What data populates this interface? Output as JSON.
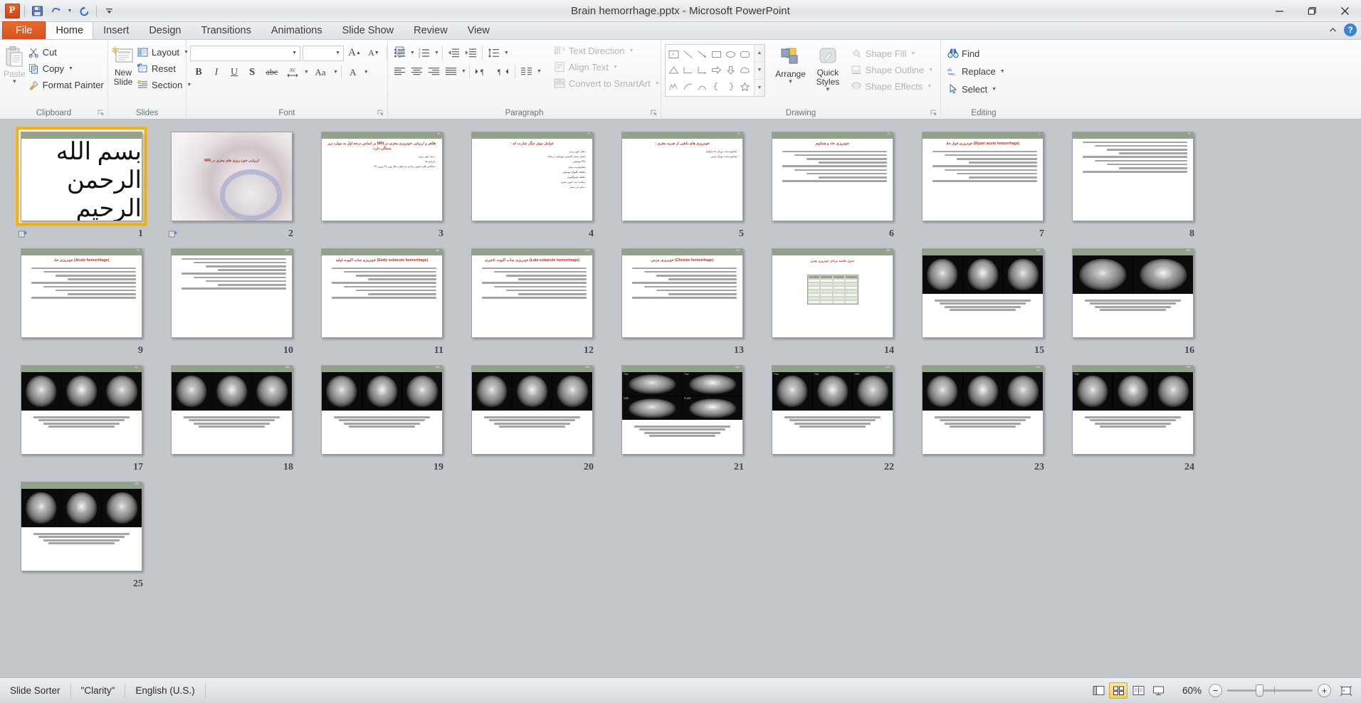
{
  "window": {
    "title": "Brain hemorrhage.pptx  -  Microsoft PowerPoint",
    "app_logo": "powerpoint-logo",
    "minimize": "—",
    "restore": "❐",
    "close": "✕",
    "ribbon_collapse": "ribbon-collapse-icon",
    "help": "?"
  },
  "quick_access": [
    {
      "name": "save",
      "icon": "save-icon"
    },
    {
      "name": "undo",
      "icon": "undo-icon"
    },
    {
      "name": "undo-dropdown",
      "icon": "chevron-down-icon"
    },
    {
      "name": "redo",
      "icon": "redo-icon"
    },
    {
      "name": "customize-qat",
      "icon": "chevron-down-icon"
    }
  ],
  "tabs": [
    {
      "label": "File",
      "active": false,
      "kind": "file"
    },
    {
      "label": "Home",
      "active": true
    },
    {
      "label": "Insert",
      "active": false
    },
    {
      "label": "Design",
      "active": false
    },
    {
      "label": "Transitions",
      "active": false
    },
    {
      "label": "Animations",
      "active": false
    },
    {
      "label": "Slide Show",
      "active": false
    },
    {
      "label": "Review",
      "active": false
    },
    {
      "label": "View",
      "active": false
    }
  ],
  "ribbon": {
    "groups": [
      {
        "label": "Clipboard",
        "has_launcher": true
      },
      {
        "label": "Slides",
        "has_launcher": false
      },
      {
        "label": "Font",
        "has_launcher": true
      },
      {
        "label": "Paragraph",
        "has_launcher": true
      },
      {
        "label": "Drawing",
        "has_launcher": true
      },
      {
        "label": "Editing",
        "has_launcher": false
      }
    ],
    "clipboard": {
      "paste": "Paste",
      "cut": "Cut",
      "copy": "Copy",
      "format_painter": "Format Painter"
    },
    "slides": {
      "new_slide_line1": "New",
      "new_slide_line2": "Slide",
      "layout": "Layout",
      "reset": "Reset",
      "section": "Section"
    },
    "font": {
      "font_name_value": "",
      "font_name_placeholder": "",
      "font_size_value": "",
      "grow_font": "A",
      "shrink_font": "A",
      "clear_formatting": "clear-formatting-icon",
      "bold": "B",
      "italic": "I",
      "underline": "U",
      "text_shadow": "S",
      "strikethrough": "abc",
      "character_spacing": "AV",
      "change_case": "Aa",
      "font_color": "A"
    },
    "paragraph": {
      "bullets": "bullets-icon",
      "numbering": "numbering-icon",
      "decrease_indent": "decrease-indent-icon",
      "increase_indent": "increase-indent-icon",
      "line_spacing": "line-spacing-icon",
      "align_left": "align-left-icon",
      "align_center": "align-center-icon",
      "align_right": "align-right-icon",
      "justify": "justify-icon",
      "ltr": "left-to-right-icon",
      "rtl": "right-to-left-icon",
      "columns": "columns-icon",
      "text_direction": "Text Direction",
      "align_text": "Align Text",
      "convert_to_smartart": "Convert to SmartArt"
    },
    "drawing": {
      "shapes": [
        "text-box-shape",
        "line-shape",
        "arrow-shape",
        "rectangle-shape",
        "oval-shape",
        "rounded-rectangle-shape",
        "triangle-shape",
        "elbow-connector-shape",
        "elbow-arrow-connector-shape",
        "right-arrow-shape",
        "down-arrow-shape",
        "cloud-shape",
        "freeform-shape",
        "curve-shape",
        "arc-shape",
        "left-brace-shape",
        "right-brace-shape",
        "star-shape"
      ],
      "gallery_up": "scroll-up-icon",
      "gallery_down": "scroll-down-icon",
      "gallery_more": "more-shapes-icon",
      "arrange": "Arrange",
      "quick_styles_line1": "Quick",
      "quick_styles_line2": "Styles",
      "shape_fill": "Shape Fill",
      "shape_outline": "Shape Outline",
      "shape_effects": "Shape Effects"
    },
    "editing": {
      "find": "Find",
      "replace": "Replace",
      "select": "Select"
    }
  },
  "slides": [
    {
      "num": "1",
      "selected": true,
      "kind": "bismillah",
      "title": "",
      "body": []
    },
    {
      "num": "2",
      "selected": false,
      "kind": "mri-machine",
      "title": "ارزیابی خون ریزی های مغزی در MRI",
      "body": []
    },
    {
      "num": "3",
      "selected": false,
      "kind": "text",
      "title": "ظاهر و ارزیابی خونریزی مغزی در MRI بر اساس درجه اول به موارد زیر بستگی دارد:",
      "body": [
        "- زمان خون ریزی",
        "- پارامتر ها",
        "- سکانس های تصویر برداری به عنوان مثال وزن T1 و وزن T2"
      ]
    },
    {
      "num": "4",
      "selected": false,
      "kind": "text",
      "title": "عوامل موثر دیگر عبارت اند :",
      "body": [
        "- محل خون ریزی",
        "- فشار نسبی اکسیژن موضعی در بافت",
        "- PH موضعی",
        "- هماتوکریت بیمار",
        "- غلظت گلوبال موضعی",
        "- غلظت هموگلوبین",
        "- سلامت سد خونی مغزی",
        "- دمای بدن بیمار"
      ]
    },
    {
      "num": "5",
      "selected": false,
      "kind": "text",
      "title": "خونریزی های ناشی از ضربه مغزی :",
      "body": [
        "هماتوم ساب دورال حاد (اولیه)",
        "هماتوم ساب دورال مزمن"
      ]
    },
    {
      "num": "6",
      "selected": false,
      "kind": "text",
      "title": "خونریزی حاد و هماتوم",
      "body": []
    },
    {
      "num": "7",
      "selected": false,
      "kind": "text",
      "title": "(Hyper acute hemorrhage) خونریزی فوق حاد",
      "body": []
    },
    {
      "num": "8",
      "selected": false,
      "kind": "text",
      "title": "",
      "body": []
    },
    {
      "num": "9",
      "selected": false,
      "kind": "text",
      "title": "(Acute hemorrhage) خونریزی حاد",
      "body": []
    },
    {
      "num": "10",
      "selected": false,
      "kind": "text",
      "title": "",
      "body": []
    },
    {
      "num": "11",
      "selected": false,
      "kind": "text",
      "title": "(Early subacute hemorrhage) خونریزی ساب اکیوت اولیه",
      "body": []
    },
    {
      "num": "12",
      "selected": false,
      "kind": "text",
      "title": "(Late subacute hemorrhage) خونریزی ساب اکیوت تاخیری",
      "body": []
    },
    {
      "num": "13",
      "selected": false,
      "kind": "text",
      "title": "(Chronic hemorrhage) خونریزی مزمن",
      "body": []
    },
    {
      "num": "14",
      "selected": false,
      "kind": "table",
      "title": "جدول خلاصه مراحل خونریزی مغزی",
      "body": []
    },
    {
      "num": "15",
      "selected": false,
      "kind": "images3",
      "title": "",
      "body": []
    },
    {
      "num": "16",
      "selected": false,
      "kind": "images2",
      "title": "",
      "body": []
    },
    {
      "num": "17",
      "selected": false,
      "kind": "images3",
      "title": "",
      "body": []
    },
    {
      "num": "18",
      "selected": false,
      "kind": "images3",
      "title": "",
      "body": []
    },
    {
      "num": "19",
      "selected": false,
      "kind": "images3",
      "title": "",
      "body": []
    },
    {
      "num": "20",
      "selected": false,
      "kind": "images3",
      "title": "",
      "body": []
    },
    {
      "num": "21",
      "selected": false,
      "kind": "images4",
      "title": "",
      "body": [],
      "tags": [
        "T2w",
        "T1w",
        "GRE",
        "FLAIR"
      ]
    },
    {
      "num": "22",
      "selected": false,
      "kind": "images3",
      "title": "",
      "body": [],
      "tags": [
        "T1w",
        "T2w",
        "GRE"
      ]
    },
    {
      "num": "23",
      "selected": false,
      "kind": "images3",
      "title": "",
      "body": []
    },
    {
      "num": "24",
      "selected": false,
      "kind": "images3",
      "title": "",
      "body": [],
      "tags": [
        "T1w"
      ]
    },
    {
      "num": "25",
      "selected": false,
      "kind": "images3",
      "title": "",
      "body": []
    }
  ],
  "status": {
    "view_mode": "Slide Sorter",
    "theme": "\"Clarity\"",
    "language": "English (U.S.)",
    "zoom_percent": "60%",
    "views": [
      {
        "name": "normal-view",
        "active": false
      },
      {
        "name": "slide-sorter-view",
        "active": true
      },
      {
        "name": "reading-view",
        "active": false
      },
      {
        "name": "slide-show-view",
        "active": false
      }
    ],
    "zoom_out": "−",
    "zoom_in": "+",
    "fit_to_window": "fit-slide-to-window-icon"
  },
  "colors": {
    "accent_orange": "#d9521b",
    "selection": "#f0b427",
    "band": "#93a18d",
    "title_red": "#b2341f",
    "desktop": "#c3c7cc"
  }
}
